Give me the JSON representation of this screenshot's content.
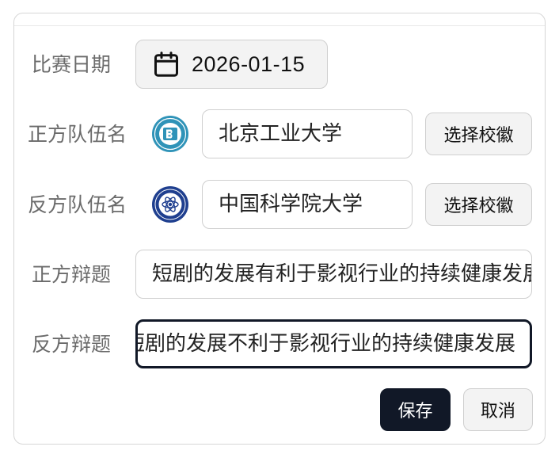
{
  "form": {
    "match_date": {
      "label": "比赛日期",
      "value": "2026-01-15",
      "icon": "calendar-icon"
    },
    "affirmative_team": {
      "label": "正方队伍名",
      "value": "北京工业大学",
      "logo_icon": "university-seal-icon",
      "logo_button": "选择校徽"
    },
    "negative_team": {
      "label": "反方队伍名",
      "value": "中国科学院大学",
      "logo_icon": "university-seal-icon",
      "logo_button": "选择校徽"
    },
    "affirmative_topic": {
      "label": "正方辩题",
      "value": "短剧的发展有利于影视行业的持续健康发展"
    },
    "negative_topic": {
      "label": "反方辩题",
      "value": "短剧的发展不利于影视行业的持续健康发展"
    }
  },
  "actions": {
    "save": "保存",
    "cancel": "取消"
  },
  "colors": {
    "primary": "#111827",
    "border": "#cfcfcf",
    "muted_text": "#6b6b6b",
    "button_bg": "#f3f3f3"
  }
}
